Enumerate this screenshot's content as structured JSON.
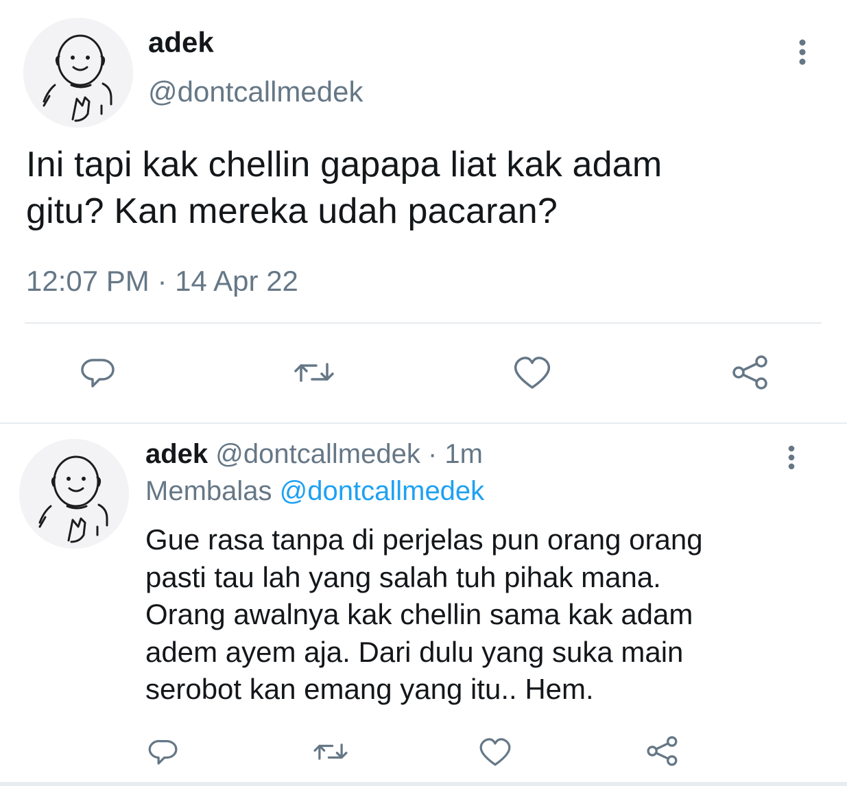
{
  "main_tweet": {
    "author_name": "adek",
    "author_handle": "@dontcallmedek",
    "text_line1": "Ini tapi kak chellin gapapa liat kak adam",
    "text_line2": "gitu? Kan mereka udah pacaran?",
    "timestamp": "12:07 PM · 14 Apr 22",
    "more_icon": "more-vertical-icon",
    "actions": {
      "reply_icon": "reply-icon",
      "retweet_icon": "retweet-icon",
      "like_icon": "heart-icon",
      "share_icon": "share-icon"
    }
  },
  "reply_tweet": {
    "author_name": "adek",
    "author_handle": "@dontcallmedek",
    "separator": "·",
    "time_ago": "1m",
    "replying_label": "Membalas",
    "replying_to": "@dontcallmedek",
    "text_lines": [
      "Gue rasa tanpa di perjelas pun orang orang",
      "pasti tau lah yang salah tuh pihak mana.",
      "Orang awalnya kak chellin sama kak adam",
      "adem ayem aja. Dari dulu yang suka main",
      "serobot kan emang yang itu.. Hem."
    ]
  },
  "colors": {
    "text_primary": "#14171a",
    "text_secondary": "#657786",
    "accent": "#1da1f2",
    "divider": "#e6ecf0",
    "avatar_bg": "#f3f2f4"
  }
}
